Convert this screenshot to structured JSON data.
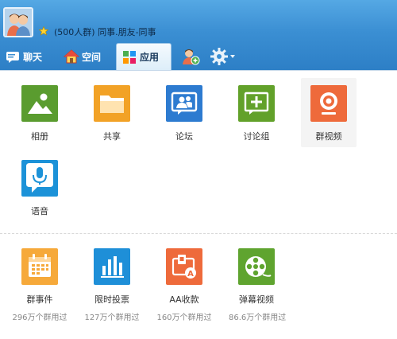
{
  "header": {
    "group_name": "(500人群) 同事.朋友-同事",
    "tabs": [
      {
        "label": "聊天",
        "icon": "chat-icon"
      },
      {
        "label": "空间",
        "icon": "home-icon"
      },
      {
        "label": "应用",
        "icon": "apps-icon"
      }
    ],
    "extra_icons": [
      "add-member-icon",
      "gear-icon"
    ]
  },
  "apps": [
    {
      "label": "相册",
      "icon": "photo-album-icon",
      "color": "#5a9c2f"
    },
    {
      "label": "共享",
      "icon": "folder-icon",
      "color": "#f2a226"
    },
    {
      "label": "论坛",
      "icon": "forum-icon",
      "color": "#2d7bd0"
    },
    {
      "label": "讨论组",
      "icon": "discussion-icon",
      "color": "#62a12a"
    },
    {
      "label": "群视频",
      "icon": "webcam-icon",
      "color": "#ee6a3b"
    },
    {
      "label": "语音",
      "icon": "microphone-icon",
      "color": "#1c92d8"
    }
  ],
  "featured_apps": [
    {
      "label": "群事件",
      "usage": "296万个群用过",
      "icon": "calendar-icon",
      "color": "#f6a93a"
    },
    {
      "label": "限时投票",
      "usage": "127万个群用过",
      "icon": "bar-chart-icon",
      "color": "#1e8fd8"
    },
    {
      "label": "AA收款",
      "usage": "160万个群用过",
      "icon": "payment-icon",
      "color": "#ee6a3b"
    },
    {
      "label": "弹幕视频",
      "usage": "86.6万个群用过",
      "icon": "film-reel-icon",
      "color": "#5fa42f"
    }
  ]
}
